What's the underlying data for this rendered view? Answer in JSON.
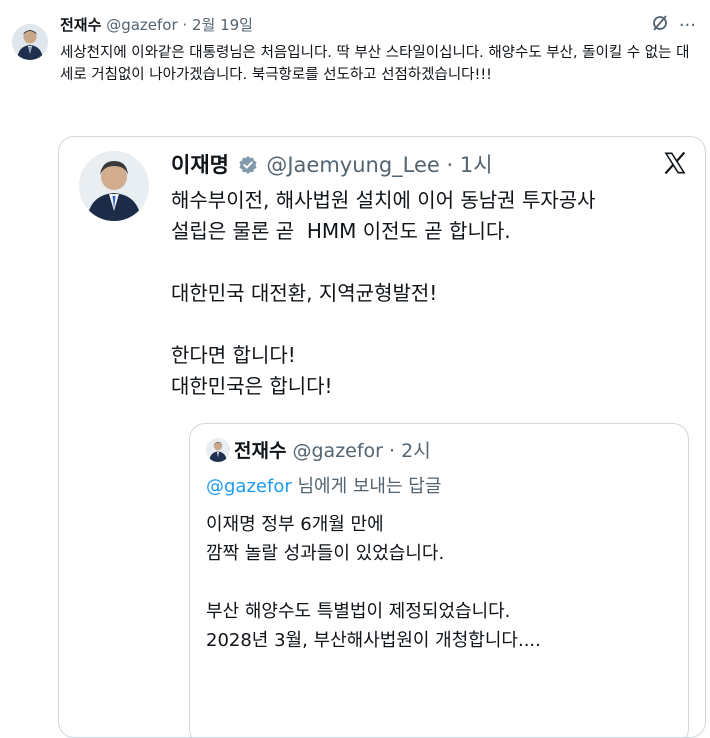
{
  "post": {
    "author_name": "전재수",
    "author_handle": "@gazefor",
    "separator": "·",
    "date": "2월 19일",
    "text": "세상천지에 이와같은 대통령님은 처음입니다. 딱 부산 스타일이십니다. 해양수도 부산, 돌이킬 수 없는 대세로 거침없이 나아가겠습니다. 북극항로를 선도하고 선점하겠습니다!!!",
    "grok_icon": "grok-icon",
    "more_label": "···"
  },
  "quoted_post": {
    "author_name": "이재명",
    "author_handle": "@Jaemyung_Lee",
    "separator": "·",
    "time": "1시",
    "text": "해수부이전, 해사법원 설치에 이어 동남권 투자공사\n설립은 물론 곧  HMM 이전도 곧 합니다.\n\n대한민국 대전환, 지역균형발전!\n\n한다면 합니다!\n대한민국은 합니다!",
    "verified_color": "#829aab",
    "x_logo": "x-logo"
  },
  "nested_post": {
    "author_name": "전재수",
    "author_handle": "@gazefor",
    "separator": "·",
    "time": "2시",
    "reply_mention": "@gazefor",
    "reply_suffix": " 님에게 보내는 답글",
    "text": "이재명 정부 6개월 만에\n깜짝 놀랄 성과들이 있었습니다.\n\n부산 해양수도 특별법이 제정되었습니다.\n2028년 3월, 부산해사법원이 개청합니다...."
  },
  "colors": {
    "text": "#0f1419",
    "muted": "#536471",
    "link": "#1d9bf0",
    "border": "#cfd9de"
  }
}
